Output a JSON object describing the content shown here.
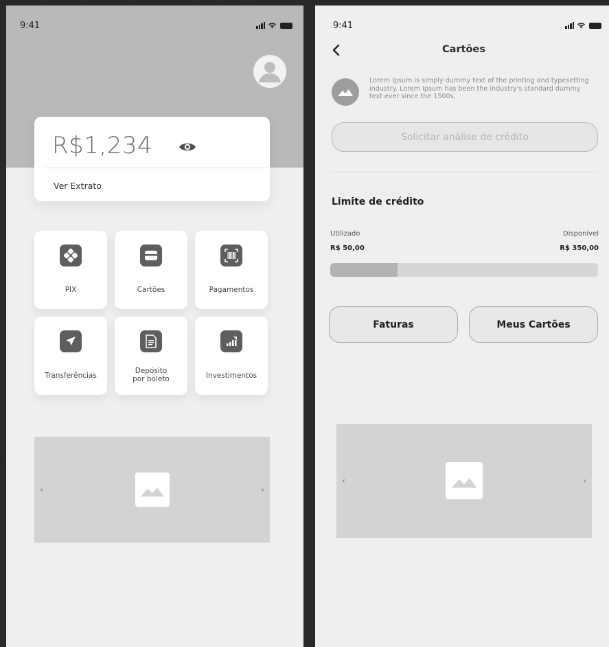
{
  "status_bar": {
    "time": "9:41"
  },
  "home": {
    "balance": {
      "value": "R$1,234",
      "statement_link": "Ver Extrato"
    },
    "menu": [
      {
        "id": "pix",
        "label": "PIX",
        "icon": "pix-icon"
      },
      {
        "id": "cartoes",
        "label": "Cartões",
        "icon": "card-icon"
      },
      {
        "id": "pagamentos",
        "label": "Pagamentos",
        "icon": "barcode-icon"
      },
      {
        "id": "transferencias",
        "label": "Transferências",
        "icon": "send-icon"
      },
      {
        "id": "deposito",
        "label": "Depósito por boleto",
        "icon": "document-icon"
      },
      {
        "id": "investimentos",
        "label": "Investimentos",
        "icon": "chart-icon"
      }
    ],
    "carousel": {
      "prev": "‹",
      "next": "›"
    }
  },
  "cards": {
    "title": "Cartões",
    "info_text": "Lorem Ipsum is simply dummy text of the printing and typesetting industry. Lorem Ipsum has been the industry's standard dummy text ever since the 1500s,",
    "credit_request_button": "Solicitar análise de crédito",
    "limit": {
      "title": "Limite de crédito",
      "used_label": "Utilizado",
      "used_value": "R$ 50,00",
      "available_label": "Disponível",
      "available_value": "R$ 350,00",
      "used_fraction": 0.25
    },
    "invoices_button": "Faturas",
    "my_cards_button": "Meus Cartões",
    "carousel": {
      "prev": "‹",
      "next": "›"
    }
  },
  "colors": {
    "header_gray": "#b9b9b9",
    "screen_bg": "#f0efee",
    "icon_dark": "#5e5e5e",
    "placeholder_gray": "#d3d3d3"
  }
}
